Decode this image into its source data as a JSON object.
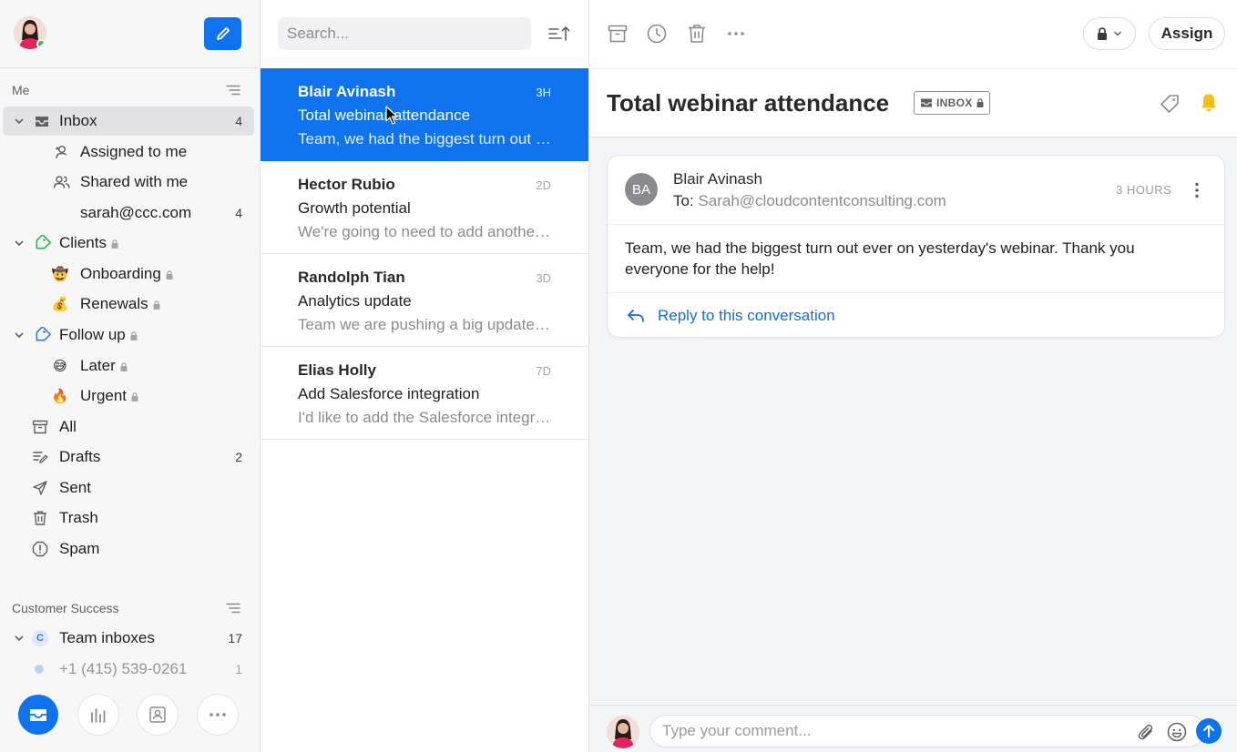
{
  "sidebar": {
    "me_heading": "Me",
    "items": [
      {
        "label": "Inbox",
        "count": "4"
      },
      {
        "label": "Assigned to me",
        "count": ""
      },
      {
        "label": "Shared with me",
        "count": ""
      },
      {
        "label": "sarah@ccc.com",
        "count": "4"
      },
      {
        "label": "Clients",
        "count": ""
      },
      {
        "label": "Onboarding",
        "count": ""
      },
      {
        "label": "Renewals",
        "count": ""
      },
      {
        "label": "Follow up",
        "count": ""
      },
      {
        "label": "Later",
        "count": ""
      },
      {
        "label": "Urgent",
        "count": ""
      },
      {
        "label": "All",
        "count": ""
      },
      {
        "label": "Drafts",
        "count": "2"
      },
      {
        "label": "Sent",
        "count": ""
      },
      {
        "label": "Trash",
        "count": ""
      },
      {
        "label": "Spam",
        "count": ""
      }
    ],
    "team_heading": "Customer Success",
    "team_items": [
      {
        "label": "Team inboxes",
        "count": "17",
        "badge": "C"
      },
      {
        "label": "+1 (415) 539-0261",
        "count": "1"
      }
    ],
    "emoji": {
      "onboarding": "🤠",
      "renewals": "💰",
      "later": "😅",
      "urgent": "🔥"
    }
  },
  "list": {
    "search_placeholder": "Search...",
    "conversations": [
      {
        "from": "Blair Avinash",
        "time": "3H",
        "subject": "Total webinar attendance",
        "preview": "Team, we had the biggest turn out ever on yesterday's webinar."
      },
      {
        "from": "Hector Rubio",
        "time": "2D",
        "subject": "Growth potential",
        "preview": "We're going to need to add another seat to our plan."
      },
      {
        "from": "Randolph Tian",
        "time": "3D",
        "subject": "Analytics update",
        "preview": "Team we are pushing a big update to analytics."
      },
      {
        "from": "Elias Holly",
        "time": "7D",
        "subject": "Add Salesforce integration",
        "preview": "I'd like to add the Salesforce integration to our account."
      }
    ]
  },
  "detail": {
    "assign_label": "Assign",
    "subject": "Total webinar attendance",
    "inbox_tag": "INBOX",
    "message": {
      "initials": "BA",
      "from": "Blair Avinash",
      "to_label": "To:",
      "to_address": "Sarah@cloudcontentconsulting.com",
      "time": "3 HOURS",
      "body": "Team, we had the biggest turn out ever on yesterday's webinar. Thank you everyone for the help!",
      "reply_label": "Reply to this conversation"
    },
    "comment_placeholder": "Type your comment..."
  },
  "colors": {
    "accent": "#0f73ee",
    "online": "#2fbf4b",
    "bell": "#f6c012",
    "tag_green": "#2fb34a",
    "tag_blue": "#2d7be5"
  }
}
